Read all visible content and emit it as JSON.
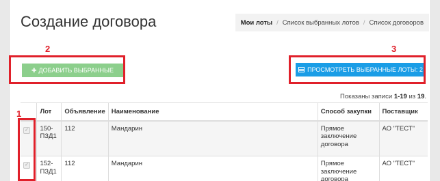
{
  "page": {
    "title": "Создание договора",
    "breadcrumbs": [
      "Мои лоты",
      "Список выбранных лотов",
      "Список договоров"
    ]
  },
  "actions": {
    "add_label": "ДОБАВИТЬ ВЫБРАННЫЕ",
    "view_label": "ПРОСМОТРЕТЬ ВЫБРАННЫЕ ЛОТЫ: 2"
  },
  "records": {
    "prefix": "Показаны записи",
    "range": "1-19",
    "mid": "из",
    "total": "19"
  },
  "table": {
    "headers": [
      "",
      "Лот",
      "Объявление",
      "Наименование",
      "Способ закупки",
      "Поставщик"
    ],
    "rows": [
      {
        "checked": true,
        "lot": "150-ПЗД1",
        "announcement": "112",
        "name": "Мандарин",
        "method": "Прямое заключение договора",
        "supplier": "АО \"ТЕСТ\""
      },
      {
        "checked": true,
        "lot": "152-ПЗД1",
        "announcement": "112",
        "name": "Мандарин",
        "method": "Прямое заключение договора",
        "supplier": "АО \"ТЕСТ\""
      }
    ]
  },
  "annotations": [
    "1",
    "2",
    "3"
  ],
  "colors": {
    "add_button": "#8ccf8c",
    "view_button": "#1a9de6",
    "annotation": "#e0202a"
  }
}
